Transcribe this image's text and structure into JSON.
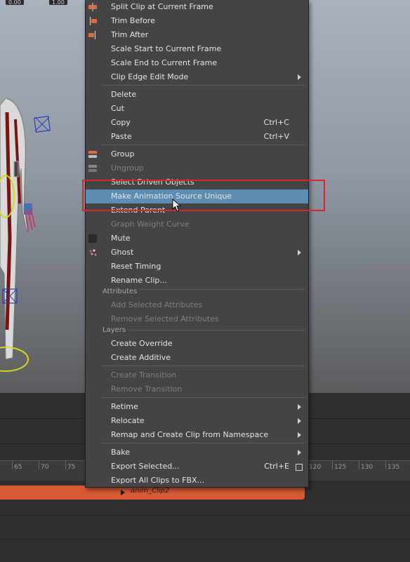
{
  "top_fields": [
    "0.00",
    "1.00"
  ],
  "menu": {
    "groups": [
      [
        {
          "label": "Split Clip at Current Frame",
          "icon": "split-clip-icon"
        },
        {
          "label": "Trim Before",
          "icon": "trim-before-icon"
        },
        {
          "label": "Trim After",
          "icon": "trim-after-icon"
        },
        {
          "label": "Scale Start to Current Frame"
        },
        {
          "label": "Scale End to Current Frame"
        },
        {
          "label": "Clip Edge Edit Mode",
          "submenu": true
        }
      ],
      [
        {
          "label": "Delete"
        },
        {
          "label": "Cut"
        },
        {
          "label": "Copy",
          "shortcut": "Ctrl+C"
        },
        {
          "label": "Paste",
          "shortcut": "Ctrl+V"
        }
      ],
      [
        {
          "label": "Group",
          "icon": "group-icon"
        },
        {
          "label": "Ungroup",
          "disabled": true,
          "icon": "ungroup-icon"
        },
        {
          "label": "Select Driven Objects"
        },
        {
          "label": "Make Animation Source Unique",
          "highlighted": true
        },
        {
          "label": "Extend Parent"
        },
        {
          "label": "Graph Weight Curve",
          "disabled": true
        },
        {
          "label": "Mute",
          "icon": "mute-icon"
        },
        {
          "label": "Ghost",
          "submenu": true,
          "icon": "ghost-icon"
        },
        {
          "label": "Reset Timing"
        },
        {
          "label": "Rename Clip..."
        }
      ]
    ],
    "attributes_header": "Attributes",
    "attributes": [
      {
        "label": "Add Selected Attributes",
        "disabled": true
      },
      {
        "label": "Remove Selected Attributes",
        "disabled": true
      }
    ],
    "layers_header": "Layers",
    "layers": [
      {
        "label": "Create Override"
      },
      {
        "label": "Create Additive"
      }
    ],
    "transitions": [
      {
        "label": "Create Transition",
        "disabled": true
      },
      {
        "label": "Remove Transition",
        "disabled": true
      }
    ],
    "retime_group": [
      {
        "label": "Retime",
        "submenu": true
      },
      {
        "label": "Relocate",
        "submenu": true
      },
      {
        "label": "Remap and Create Clip from Namespace",
        "submenu": true
      }
    ],
    "bake_group": [
      {
        "label": "Bake",
        "submenu": true
      },
      {
        "label": "Export Selected...",
        "shortcut": "Ctrl+E",
        "option_box": true
      },
      {
        "label": "Export All Clips to FBX..."
      }
    ]
  },
  "timeline": {
    "ticks": [
      "65",
      "70",
      "75",
      "120",
      "125",
      "130",
      "135"
    ],
    "clip_label": "anim_Clip2"
  },
  "colors": {
    "highlight": "#5e8db2",
    "clip": "#d75a33",
    "annotation": "#d8262b"
  }
}
